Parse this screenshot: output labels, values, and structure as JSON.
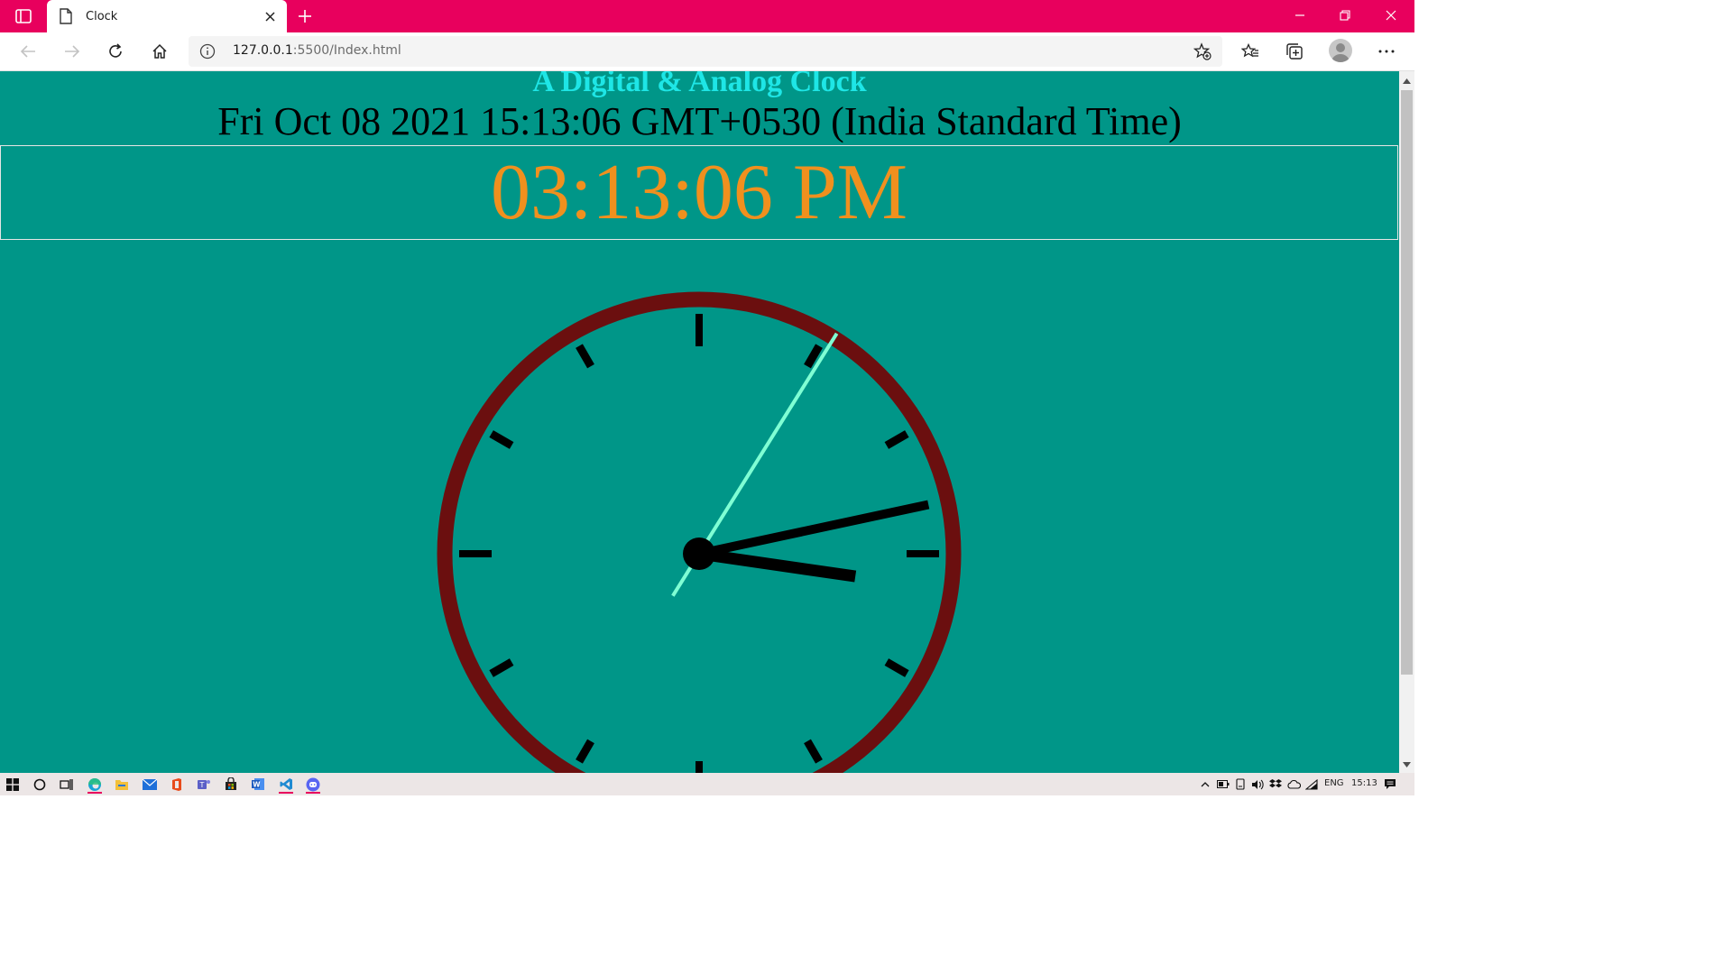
{
  "browser": {
    "tab": {
      "title": "Clock"
    },
    "address": {
      "host": "127.0.0.1",
      "path": ":5500/Index.html"
    },
    "accent_color": "#e8005d",
    "icons": [
      "tab-actions-icon",
      "page-icon",
      "close-icon",
      "plus-icon",
      "minimize-icon",
      "restore-icon",
      "close-window-icon",
      "back-arrow-icon",
      "forward-arrow-icon",
      "refresh-icon",
      "home-icon",
      "info-icon",
      "add-favorite-icon",
      "favorites-icon",
      "collections-icon",
      "profile-avatar",
      "more-options-icon"
    ]
  },
  "page": {
    "heading": "A Digital & Analog Clock",
    "date_string": "Fri Oct 08 2021 15:13:06 GMT+0530 (India Standard Time)",
    "digital_time": "03:13:06 PM",
    "colors": {
      "background": "#009688",
      "heading": "#1ee6e6",
      "digital": "#f0901e",
      "clock_rim": "#6b0f0f",
      "second_hand": "#7fffd4",
      "hands": "#000000"
    },
    "analog_clock": {
      "hour": 3,
      "minute": 13,
      "second": 6,
      "tick_marks": 12
    }
  },
  "taskbar": {
    "apps": [
      "windows-start-icon",
      "search-circle-icon",
      "task-view-icon",
      "edge-icon",
      "file-explorer-icon",
      "mail-icon",
      "office-icon",
      "teams-icon",
      "store-icon",
      "word-icon",
      "vscode-icon",
      "discord-icon"
    ],
    "tray": {
      "language": "ENG",
      "time": "15:13"
    }
  }
}
